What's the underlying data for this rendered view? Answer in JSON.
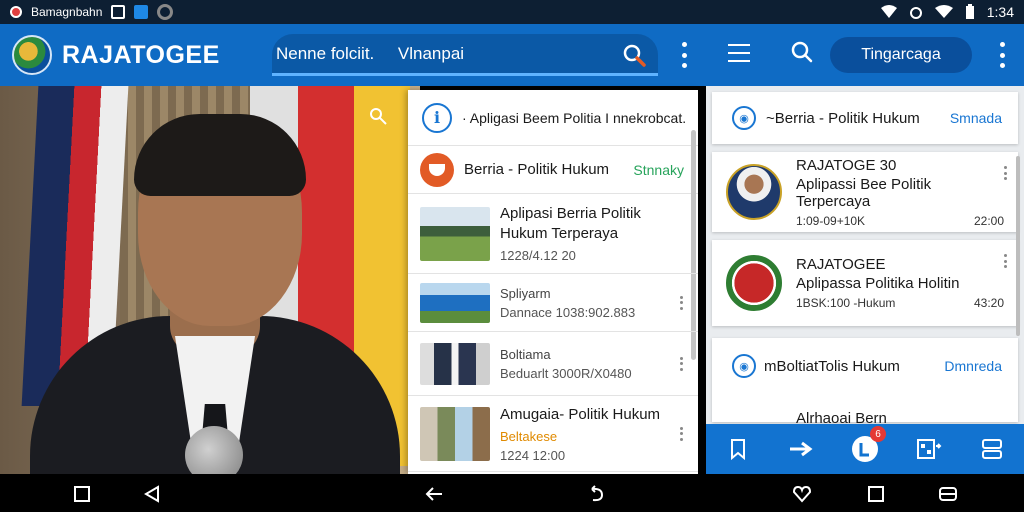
{
  "status_bar": {
    "carrier": "Bamagnbahn",
    "time": "1:34"
  },
  "app_bar": {
    "brand": "RAJATOGEE",
    "search_value": "Nenne folciit.     Vlnanpai",
    "pill_button": "Tingarcaga"
  },
  "middle_panel": {
    "header1": "· Apligasi Beem Politia I nnekrobcat.",
    "header2_title": "Berria - Politik Hukum",
    "header2_link": "Stnnaky",
    "items": [
      {
        "title": "Aplipasi Berria Politik Hukum Terperaya",
        "meta": "1228/4.12 20",
        "sub": ""
      },
      {
        "title": "",
        "sub": "Spliyarm",
        "meta": "Dannace  1038:902.883"
      },
      {
        "title": "",
        "sub": "Boltiama",
        "meta": "Beduarlt  3000R/X0480"
      },
      {
        "title": "Amugaia- Politik Hukum",
        "sub": "Beltakese",
        "meta": "1224 12:00"
      }
    ]
  },
  "right_panel": {
    "header_title": "~Berria - Politik Hukum",
    "header_link": "Smnada",
    "items": [
      {
        "title": "RAJATOGE 30",
        "sub": "Aplipassi Bee Politik Terpercaya",
        "date": "1:09-09+10K",
        "time": "22:00"
      },
      {
        "title": "RAJATOGEE",
        "sub": "Aplipassa Politika Holitin",
        "date": "1BSK:100 -Hukum",
        "time": "43:20"
      }
    ],
    "section_title": "mBoltiatTolis Hukum",
    "section_link": "Dmnreda",
    "partial_item": "Alrhaoai Bern",
    "toolbar_badge": "6"
  },
  "colors": {
    "primary": "#0f6bc4",
    "accent_green": "#27a35b",
    "accent_orange": "#e25b26"
  }
}
